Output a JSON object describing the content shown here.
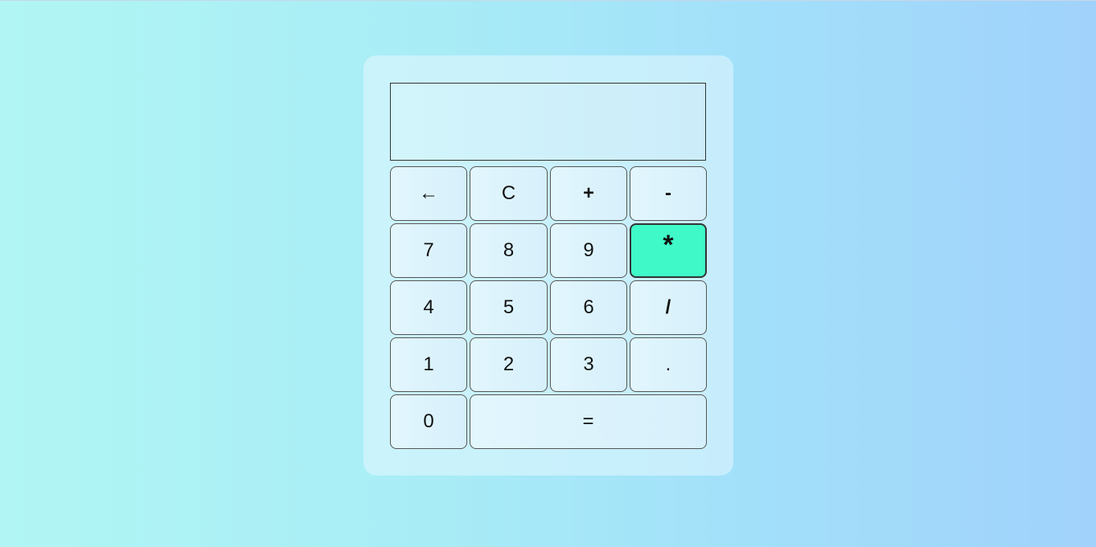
{
  "calculator": {
    "display_value": "",
    "keys": {
      "backspace": "←",
      "clear": "C",
      "plus": "+",
      "minus": "-",
      "seven": "7",
      "eight": "8",
      "nine": "9",
      "multiply": "*",
      "four": "4",
      "five": "5",
      "six": "6",
      "divide": "/",
      "one": "1",
      "two": "2",
      "three": "3",
      "dot": ".",
      "zero": "0",
      "equals": "="
    },
    "active_key_color": "#3ffac8"
  }
}
